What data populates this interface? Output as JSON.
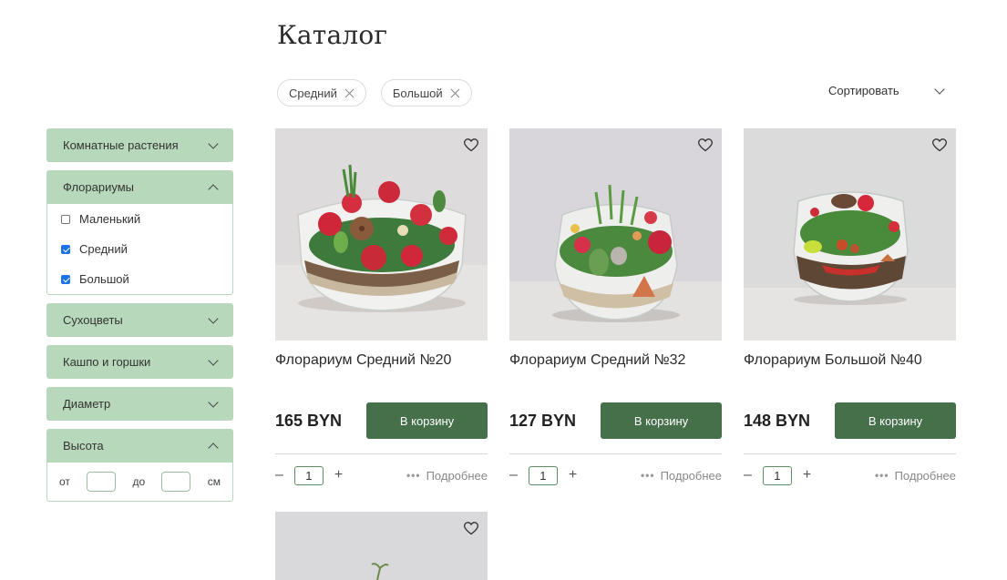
{
  "page": {
    "title": "Каталог"
  },
  "active_filters": [
    {
      "label": "Средний"
    },
    {
      "label": "Большой"
    }
  ],
  "sort": {
    "label": "Сортировать"
  },
  "sidebar": {
    "groups": [
      {
        "label": "Комнатные растения",
        "open": false
      },
      {
        "label": "Флорариумы",
        "open": true,
        "options": [
          {
            "label": "Маленький",
            "checked": false
          },
          {
            "label": "Средний",
            "checked": true
          },
          {
            "label": "Большой",
            "checked": true
          }
        ]
      },
      {
        "label": "Сухоцветы",
        "open": false
      },
      {
        "label": "Кашпо и горшки",
        "open": false
      },
      {
        "label": "Диаметр",
        "open": false
      },
      {
        "label": "Высота",
        "open": true,
        "range": {
          "from_label": "от",
          "to_label": "до",
          "unit": "см"
        }
      }
    ]
  },
  "products": [
    {
      "title": "Флорариум Средний №20",
      "price": "165 BYN",
      "button": "В корзину",
      "qty": "1",
      "more": "Подробнее"
    },
    {
      "title": "Флорариум Средний №32",
      "price": "127 BYN",
      "button": "В корзину",
      "qty": "1",
      "more": "Подробнее"
    },
    {
      "title": "Флорариум Большой №40",
      "price": "148 BYN",
      "button": "В корзину",
      "qty": "1",
      "more": "Подробнее"
    }
  ],
  "qty_controls": {
    "minus": "–",
    "plus": "+"
  },
  "colors": {
    "accent": "#45704a",
    "filter_bg": "#b8d8bb"
  }
}
